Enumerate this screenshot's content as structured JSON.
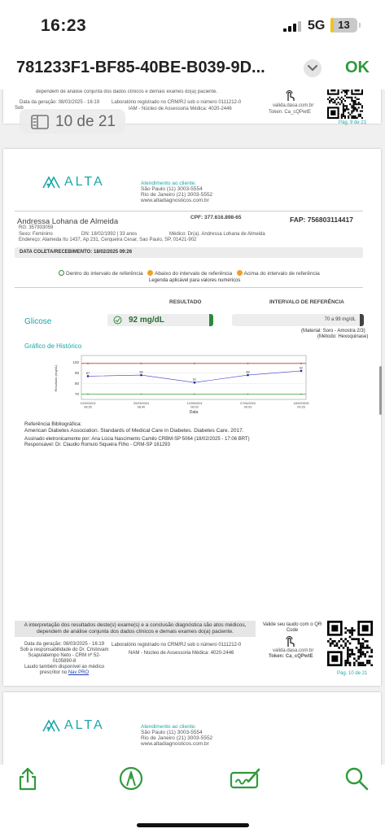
{
  "status": {
    "time": "16:23",
    "network": "5G",
    "battery": "13",
    "battery_level": 0.13
  },
  "header": {
    "title": "781233F1-BF85-40BE-B039-9D...",
    "ok_label": "OK"
  },
  "page_indicator": "10 de 21",
  "prev_page": {
    "disclaimer_fragment": "dependem de análise conjunta dos dados clínicos e demais exames do(a) paciente.",
    "gen_date": "Data da geração: 08/03/2025 - 16:19",
    "sob": "Sob",
    "lab_reg": "Laboratório registrado no CRM/RJ sob o número 0111212-0",
    "nam": "IAM - Núcleo de Assessoria Médica: 4020-2446",
    "l": "L",
    "valida_url": "valida.dasa.com.br",
    "token": "Token: Ca_cQPwtE",
    "page_label": "Pág. 9 de 21"
  },
  "page": {
    "logo_text": "ALTA",
    "contact": {
      "heading": "Atendimento ao cliente:",
      "sp": "São Paulo (11) 3003-5554",
      "rj": "Rio de Janeiro (21) 3003-5552",
      "site": "www.altadiagnosticos.com.br"
    },
    "patient": {
      "name": "Andressa Lohana de Almeida",
      "cpf": "CPF: 377.616.898-65",
      "fap": "FAP: 756803114417",
      "rg": "RG: 357933059",
      "sexo": "Sexo: Feminino",
      "dn": "DN: 18/02/1992 | 33 anos",
      "medico": "Médico: Dr(a). Andressa Lohana de Almeida",
      "endereco": "Endereço: Alameda Itu 1437, Ap 231, Cerqueira Cesar, Sao Paulo, SP, 01421-902"
    },
    "coleta": "DATA COLETA/RECEBIMENTO: 18/02/2025 09:26",
    "legend": {
      "dentro": "Dentro do intervalo de referência",
      "abaixo": "Abaixo do intervalo de referência",
      "acima": "Acima do intervalo de referência",
      "aplicavel": "Legenda aplicável para valores numéricos"
    },
    "col_resultado": "RESULTADO",
    "col_intervalo": "INTERVALO DE REFERÊNCIA",
    "exam": {
      "name": "Glicose",
      "value": "92 mg/dL",
      "ref": "70 a 99 mg/dL",
      "material": "(Material: Soro - Amostra 2/3)",
      "metodo": "(Método: Hexoquinase)"
    },
    "historico_title": "Gráfico de Histórico",
    "bib_title": "Referência Bibliográfica:",
    "bib_text": "American Diabetes Association. Standards of Medical Care in Diabetes. Diabetes Care. 2017.",
    "assinado": "Assinado eletronicamente por: Ana Lúcia Nascimento Camilo CRBM-SP 5064 (18/02/2025 - 17:06 BRT)",
    "responsavel": "Responsável: Dr. Claudio Romulo Siqueira Filho - CRM-SP 161293",
    "disclaimer_1": "A interpretação dos resultados deste(s) exame(s) e a conclusão diagnóstica são atos médicos,",
    "disclaimer_2": "dependem de análise conjunta dos dados clínicos e demais exames do(a) paciente.",
    "valide_1": "Valide seu laudo com o QR",
    "valide_2": "Code",
    "valida_url": "valida.dasa.com.br",
    "token": "Token: Ca_cQPwtE",
    "gen_date": "Data da geração: 08/03/2025 - 16:19",
    "lab_reg": "Laboratório registrado no CRM/RJ sob o número 0111212-0",
    "nam": "NAM - Núcleo de Assessoria Médica: 4020-2446",
    "resp_1": "Sob a responsabilidade do Dr. Cristovam",
    "resp_2": "Scapulatempo Neto - CRM nº 52-",
    "resp_3": "0105890-8",
    "laudo_1": "Laudo também disponível ao médico",
    "laudo_2": "prescritor no",
    "nav_pro": "Nav PRO",
    "page_label": "Pág. 10 de 21"
  },
  "chart_data": {
    "type": "line",
    "x": [
      "10/02/2024 08:35",
      "20/03/2024 08:40",
      "12/05/2024 08:53",
      "27/06/2024 09:03",
      "18/02/2025 09:26"
    ],
    "xlabel": "Data",
    "ylabel": "Resultado (mg/dL)",
    "ylim": [
      65,
      105
    ],
    "yticks": [
      70,
      80,
      90,
      100
    ],
    "series": [
      {
        "values": [
          87,
          88,
          81,
          88,
          92
        ]
      }
    ],
    "reference_lines": {
      "upper": 99,
      "lower": 70
    },
    "colors": {
      "series": "#3a3ac8",
      "upper": "#d43b3b",
      "lower": "#3aa63a"
    }
  },
  "next_page": {
    "logo_text": "ALTA",
    "contact": {
      "heading": "Atendimento ao cliente:",
      "sp": "São Paulo (11) 3003-5554",
      "rj": "Rio de Janeiro (21) 3003-5552",
      "site": "www.altadiagnosticos.com.br"
    }
  },
  "toolbar": {
    "icons": [
      "share-icon",
      "markup-icon",
      "signature-icon",
      "search-icon"
    ],
    "accent": "#2f9a3c"
  }
}
